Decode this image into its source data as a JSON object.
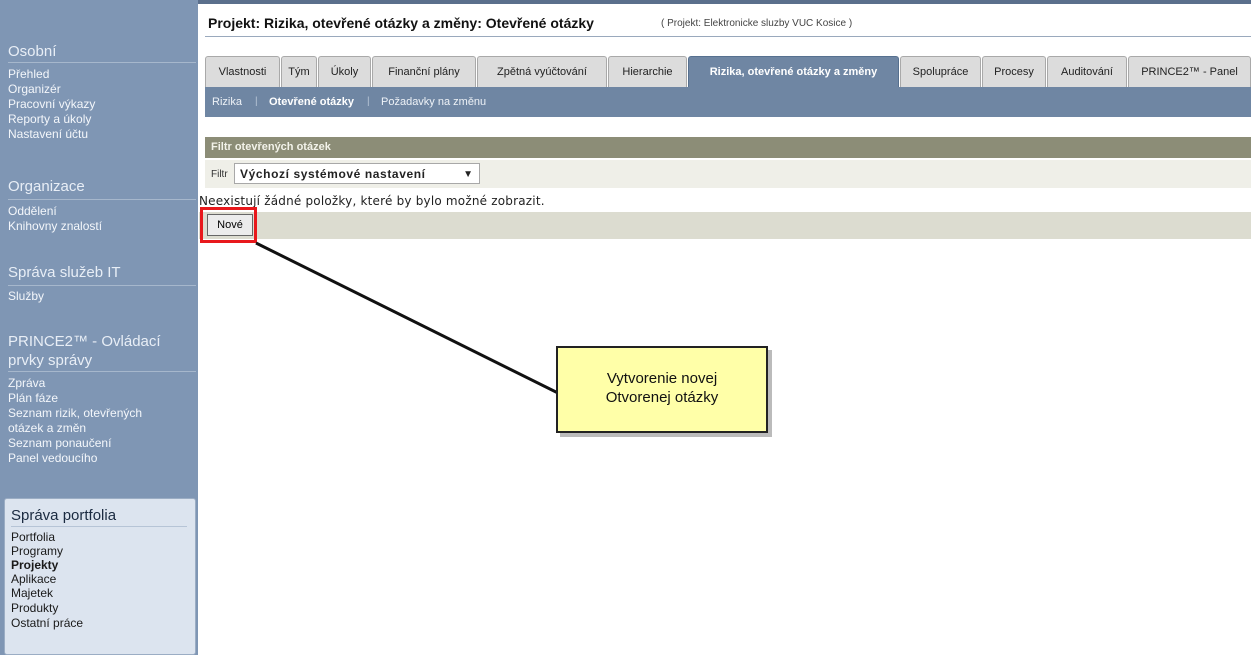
{
  "sidebar": {
    "sections": [
      {
        "title": "Osobní",
        "items": [
          "Přehled",
          "Organizér",
          "Pracovní výkazy",
          "Reporty a úkoly",
          "Nastavení účtu"
        ]
      },
      {
        "title": "Organizace",
        "items": [
          "Oddělení",
          "Knihovny znalostí"
        ]
      },
      {
        "title": "Správa služeb IT",
        "items": [
          "Služby"
        ]
      },
      {
        "title_line1": "PRINCE2™ - Ovládací",
        "title_line2": "prvky správy",
        "items": [
          "Zpráva",
          "Plán fáze",
          "Seznam rizik, otevřených",
          "otázek a změn",
          "Seznam ponaučení",
          "Panel vedoucího"
        ]
      },
      {
        "title": "Správa portfolia",
        "items": [
          "Portfolia",
          "Programy",
          "Projekty",
          "Aplikace",
          "Majetek",
          "Produkty",
          "Ostatní práce"
        ],
        "active_item": "Projekty"
      }
    ]
  },
  "header": {
    "title": "Projekt: Rizika, otevřené otázky a změny: Otevřené otázky",
    "subtitle": "( Projekt: Elektronicke sluzby VUC Kosice )"
  },
  "tabs": [
    "Vlastnosti",
    "Tým",
    "Úkoly",
    "Finanční plány",
    "Zpětná vyúčtování",
    "Hierarchie",
    "Rizika, otevřené otázky a změny",
    "Spolupráce",
    "Procesy",
    "Auditování",
    "PRINCE2™ - Panel"
  ],
  "active_tab": "Rizika, otevřené otázky a změny",
  "subnav": {
    "items": [
      "Rizika",
      "Otevřené otázky",
      "Požadavky na změnu"
    ],
    "active": "Otevřené otázky",
    "separator": "|"
  },
  "filter": {
    "header": "Filtr otevřených otázek",
    "label": "Filtr",
    "selected": "Výchozí systémové nastavení",
    "arrow": "▼"
  },
  "empty_message": "Neexistují žádné položky, které by bylo možné zobrazit.",
  "new_button_label": "Nové",
  "callout": {
    "line1": "Vytvorenie novej",
    "line2": "Otvorenej otázky"
  },
  "colors": {
    "sidebar": "#7f96b4",
    "active_tab": "#6f86a3",
    "filter_header": "#8c8d77",
    "highlight": "#e8181c",
    "callout_bg": "#ffffa8"
  }
}
